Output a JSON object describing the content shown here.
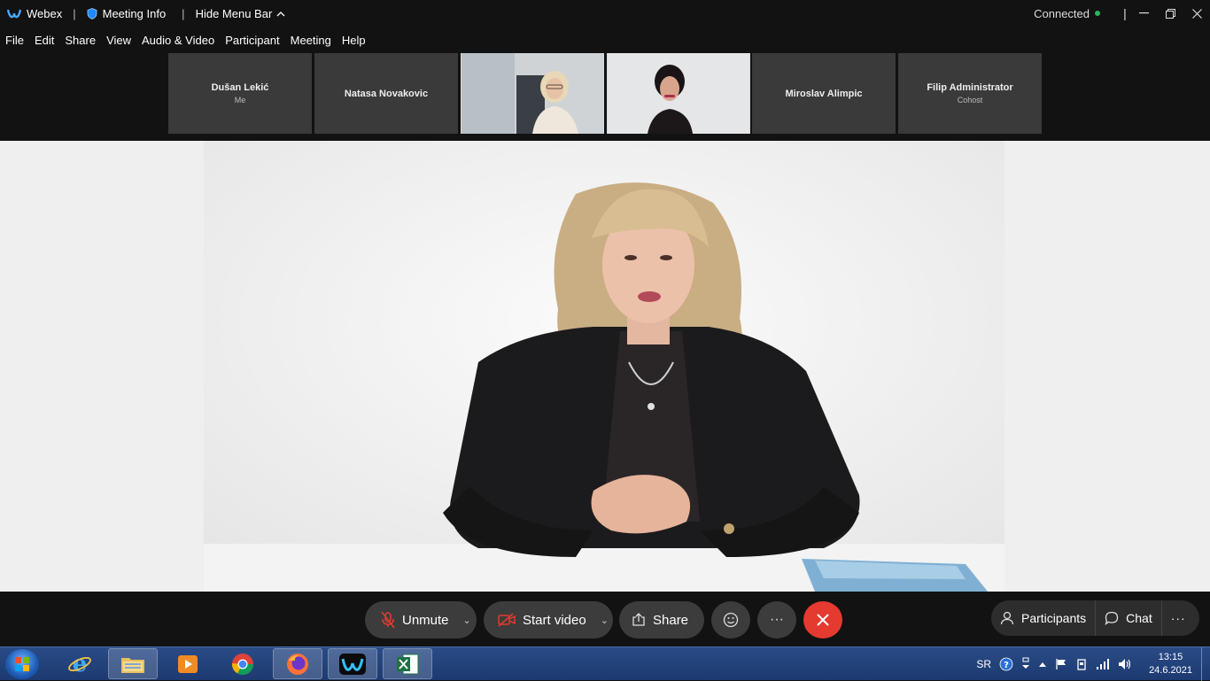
{
  "titlebar": {
    "app": "Webex",
    "meeting_info": "Meeting Info",
    "hide_menu_bar": "Hide Menu Bar",
    "status": "Connected"
  },
  "menu": [
    "File",
    "Edit",
    "Share",
    "View",
    "Audio & Video",
    "Participant",
    "Meeting",
    "Help"
  ],
  "participants": [
    {
      "name": "Dušan Lekić",
      "role": "Me"
    },
    {
      "name": "Natasa Novakovic",
      "role": ""
    },
    {
      "name": "",
      "role": ""
    },
    {
      "name": "",
      "role": ""
    },
    {
      "name": "Miroslav Alimpic",
      "role": ""
    },
    {
      "name": "Filip Administrator",
      "role": "Cohost"
    }
  ],
  "controls": {
    "unmute": "Unmute",
    "start_video": "Start video",
    "share": "Share",
    "participants": "Participants",
    "chat": "Chat"
  },
  "taskbar": {
    "lang": "SR",
    "time": "13:15",
    "date": "24.6.2021"
  },
  "colors": {
    "end_call": "#e53a2f",
    "connected": "#2fb25a",
    "taskbar": "#1d3a70"
  }
}
